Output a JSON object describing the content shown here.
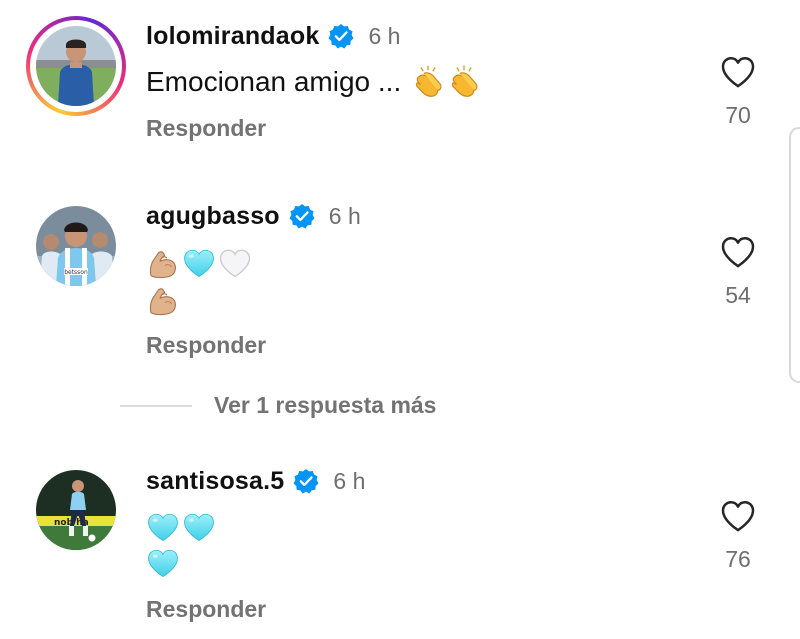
{
  "comments": [
    {
      "username": "lolomirandaok",
      "verified": true,
      "time": "6 h",
      "text": "Emocionan amigo ...",
      "emoji_line1": [
        "clapping-hands",
        "clapping-hands"
      ],
      "reply_label": "Responder",
      "likes": "70",
      "has_story_ring": true
    },
    {
      "username": "agugbasso",
      "verified": true,
      "time": "6 h",
      "emoji_line1": [
        "flexed-biceps",
        "light-blue-heart",
        "white-heart"
      ],
      "emoji_line2": [
        "flexed-biceps"
      ],
      "reply_label": "Responder",
      "likes": "54",
      "has_story_ring": false
    },
    {
      "username": "santisosa.5",
      "verified": true,
      "time": "6 h",
      "emoji_line1": [
        "light-blue-heart",
        "light-blue-heart"
      ],
      "emoji_line2": [
        "light-blue-heart"
      ],
      "reply_label": "Responder",
      "likes": "76",
      "has_story_ring": false
    }
  ],
  "more_replies_label": "Ver 1 respuesta más",
  "colors": {
    "verified_blue": "#0095f6",
    "secondary_text": "#737373",
    "light_blue_heart": "#6fe0f5"
  }
}
